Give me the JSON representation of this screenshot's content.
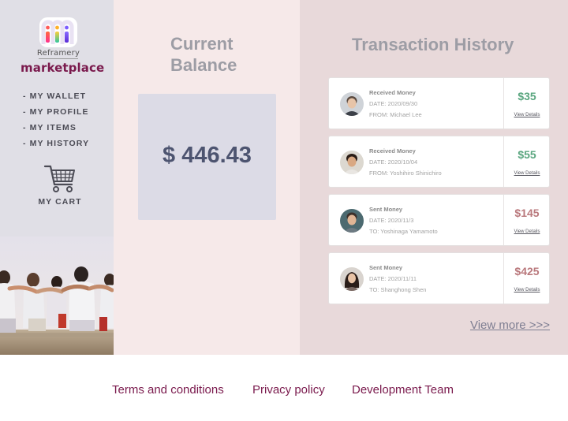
{
  "brand": {
    "name": "Reframery",
    "title": "marketplace"
  },
  "sidebar": {
    "items": [
      {
        "label": "- MY WALLET"
      },
      {
        "label": "- MY PROFILE"
      },
      {
        "label": "- MY ITEMS"
      },
      {
        "label": "- MY HISTORY"
      }
    ],
    "cart_label": "MY CART",
    "cart_icon": "shopping-cart-icon"
  },
  "balance": {
    "title_line1": "Current",
    "title_line2": "Balance",
    "amount": "$ 446.43"
  },
  "transactions": {
    "title": "Transaction History",
    "items": [
      {
        "type": "Received Money",
        "date": "DATE: 2020/09/30",
        "party": "FROM: Michael Lee",
        "amount": "$35",
        "direction": "in",
        "link": "View Details"
      },
      {
        "type": "Received Money",
        "date": "DATE: 2020/10/04",
        "party": "FROM: Yoshihiro Shinichiro",
        "amount": "$55",
        "direction": "in",
        "link": "View Details"
      },
      {
        "type": "Sent Money",
        "date": "DATE: 2020/11/3",
        "party": "TO: Yoshinaga Yamamoto",
        "amount": "$145",
        "direction": "out",
        "link": "View Details"
      },
      {
        "type": "Sent Money",
        "date": "DATE: 2020/11/11",
        "party": "TO: Shanghong Shen",
        "amount": "$425",
        "direction": "out",
        "link": "View Details"
      }
    ],
    "view_more": "View more >>>"
  },
  "footer": {
    "links": [
      {
        "label": "Terms and conditions"
      },
      {
        "label": "Privacy policy"
      },
      {
        "label": "Development Team"
      }
    ]
  },
  "colors": {
    "brand": "#7a1a4d",
    "incoming": "#5aa67f",
    "outgoing": "#b9787c",
    "sidebar_bg": "#e0dfe6",
    "balance_bg": "#f6e9e9",
    "history_bg": "#e8d9da"
  }
}
